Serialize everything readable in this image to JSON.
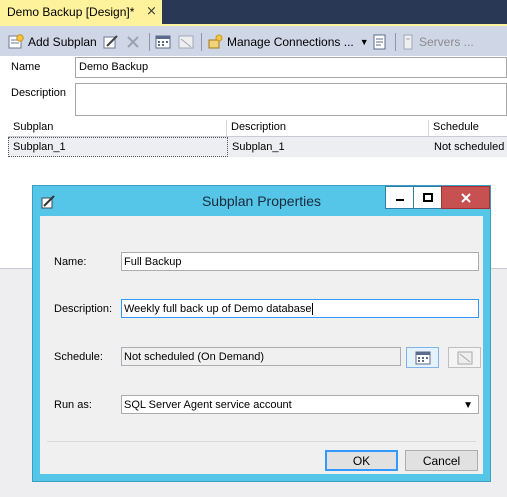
{
  "tab": {
    "title": "Demo Backup [Design]*",
    "close": "⨯"
  },
  "toolbar": {
    "add_subplan": "Add Subplan",
    "manage_connections": "Manage Connections ...",
    "servers": "Servers ..."
  },
  "form": {
    "name_label": "Name",
    "name_value": "Demo Backup",
    "description_label": "Description",
    "description_value": ""
  },
  "grid": {
    "columns": [
      "Subplan",
      "Description",
      "Schedule"
    ],
    "rows": [
      {
        "subplan": "Subplan_1",
        "description": "Subplan_1",
        "schedule": "Not scheduled ("
      }
    ]
  },
  "dialog": {
    "title": "Subplan Properties",
    "name_label": "Name:",
    "name_value": "Full Backup",
    "description_label": "Description:",
    "description_value": "Weekly full back up of Demo database",
    "schedule_label": "Schedule:",
    "schedule_value": "Not scheduled (On Demand)",
    "runas_label": "Run as:",
    "runas_value": "SQL Server Agent service account",
    "ok_label": "OK",
    "cancel_label": "Cancel"
  },
  "colors": {
    "tab_active": "#FFF29D",
    "toolbar": "#CFD6E5",
    "dialog_frame": "#56C6E8",
    "close_button": "#C75050",
    "ide_background": "#293955"
  }
}
